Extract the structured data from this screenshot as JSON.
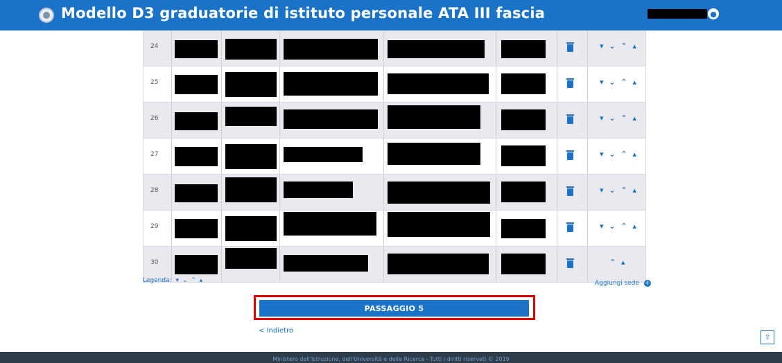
{
  "header": {
    "title": "Modello D3 graduatorie di istituto personale ATA III fascia",
    "user_icon": "user-icon",
    "accent": "#1a73c7"
  },
  "table": {
    "rows": [
      {
        "num": "24",
        "arrows": "▾ ⌄ ⌃ ▴"
      },
      {
        "num": "25",
        "arrows": "▾ ⌄ ⌃ ▴"
      },
      {
        "num": "26",
        "arrows": "▾ ⌄ ⌃ ▴"
      },
      {
        "num": "27",
        "arrows": "▾ ⌄ ⌃ ▴"
      },
      {
        "num": "28",
        "arrows": "▾ ⌄ ⌃ ▴"
      },
      {
        "num": "29",
        "arrows": "▾ ⌄ ⌃ ▴"
      },
      {
        "num": "30",
        "arrows": "⌃ ▴"
      }
    ]
  },
  "legend": {
    "label": "Legenda:",
    "symbols": "▾ ⌄ ⌃ ▴"
  },
  "add_seat": {
    "label": "Aggiungi sede",
    "icon": "⊕"
  },
  "primary_button": {
    "label": "PASSAGGIO 5",
    "highlight": "#e00000"
  },
  "back": {
    "label": "< Indietro"
  },
  "scroll_top": {
    "icon": "⇧"
  },
  "footer": {
    "text": "Ministero dell'Istruzione, dell'Università e della Ricerca - Tutti i diritti riservati © 2019"
  }
}
